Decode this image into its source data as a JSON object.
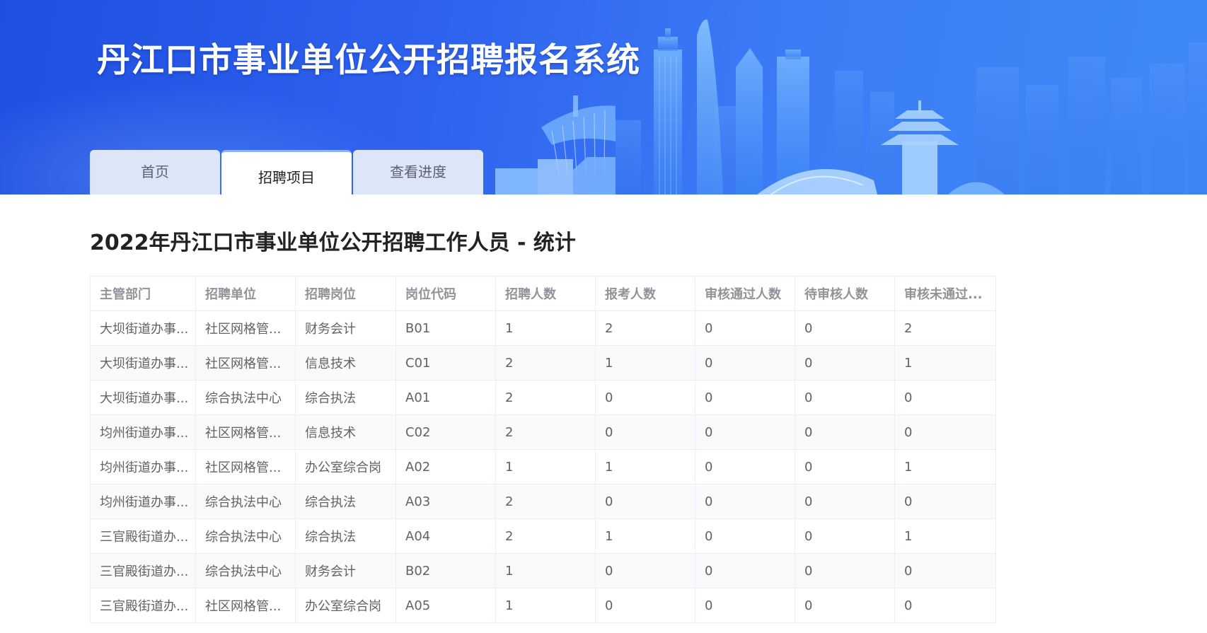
{
  "header": {
    "site_title": "丹江口市事业单位公开招聘报名系统"
  },
  "tabs": [
    {
      "label": "首页"
    },
    {
      "label": "招聘项目"
    },
    {
      "label": "查看进度"
    }
  ],
  "active_tab": "招聘项目",
  "main": {
    "section_title": "2022年丹江口市事业单位公开招聘工作人员 - 统计"
  },
  "table": {
    "columns": [
      "主管部门",
      "招聘单位",
      "招聘岗位",
      "岗位代码",
      "招聘人数",
      "报考人数",
      "审核通过人数",
      "待审核人数",
      "审核未通过..."
    ],
    "rows": [
      [
        "大坝街道办事...",
        "社区网格管...",
        "财务会计",
        "B01",
        "1",
        "2",
        "0",
        "0",
        "2"
      ],
      [
        "大坝街道办事...",
        "社区网格管...",
        "信息技术",
        "C01",
        "2",
        "1",
        "0",
        "0",
        "1"
      ],
      [
        "大坝街道办事...",
        "综合执法中心",
        "综合执法",
        "A01",
        "2",
        "0",
        "0",
        "0",
        "0"
      ],
      [
        "均州街道办事...",
        "社区网格管...",
        "信息技术",
        "C02",
        "2",
        "0",
        "0",
        "0",
        "0"
      ],
      [
        "均州街道办事...",
        "社区网格管...",
        "办公室综合岗",
        "A02",
        "1",
        "1",
        "0",
        "0",
        "1"
      ],
      [
        "均州街道办事...",
        "综合执法中心",
        "综合执法",
        "A03",
        "2",
        "0",
        "0",
        "0",
        "0"
      ],
      [
        "三官殿街道办...",
        "综合执法中心",
        "综合执法",
        "A04",
        "2",
        "1",
        "0",
        "0",
        "1"
      ],
      [
        "三官殿街道办...",
        "综合执法中心",
        "财务会计",
        "B02",
        "1",
        "0",
        "0",
        "0",
        "0"
      ],
      [
        "三官殿街道办...",
        "社区网格管...",
        "办公室综合岗",
        "A05",
        "1",
        "0",
        "0",
        "0",
        "0"
      ]
    ]
  },
  "colors": {
    "banner_start": "#1f4fe0",
    "banner_end": "#3e8af7",
    "tab_inactive_bg": "#dde6f8",
    "tab_active_bg": "#ffffff",
    "header_text": "#909399",
    "cell_text": "#606266",
    "border": "#ebeef5",
    "stripe": "#fafafa"
  }
}
